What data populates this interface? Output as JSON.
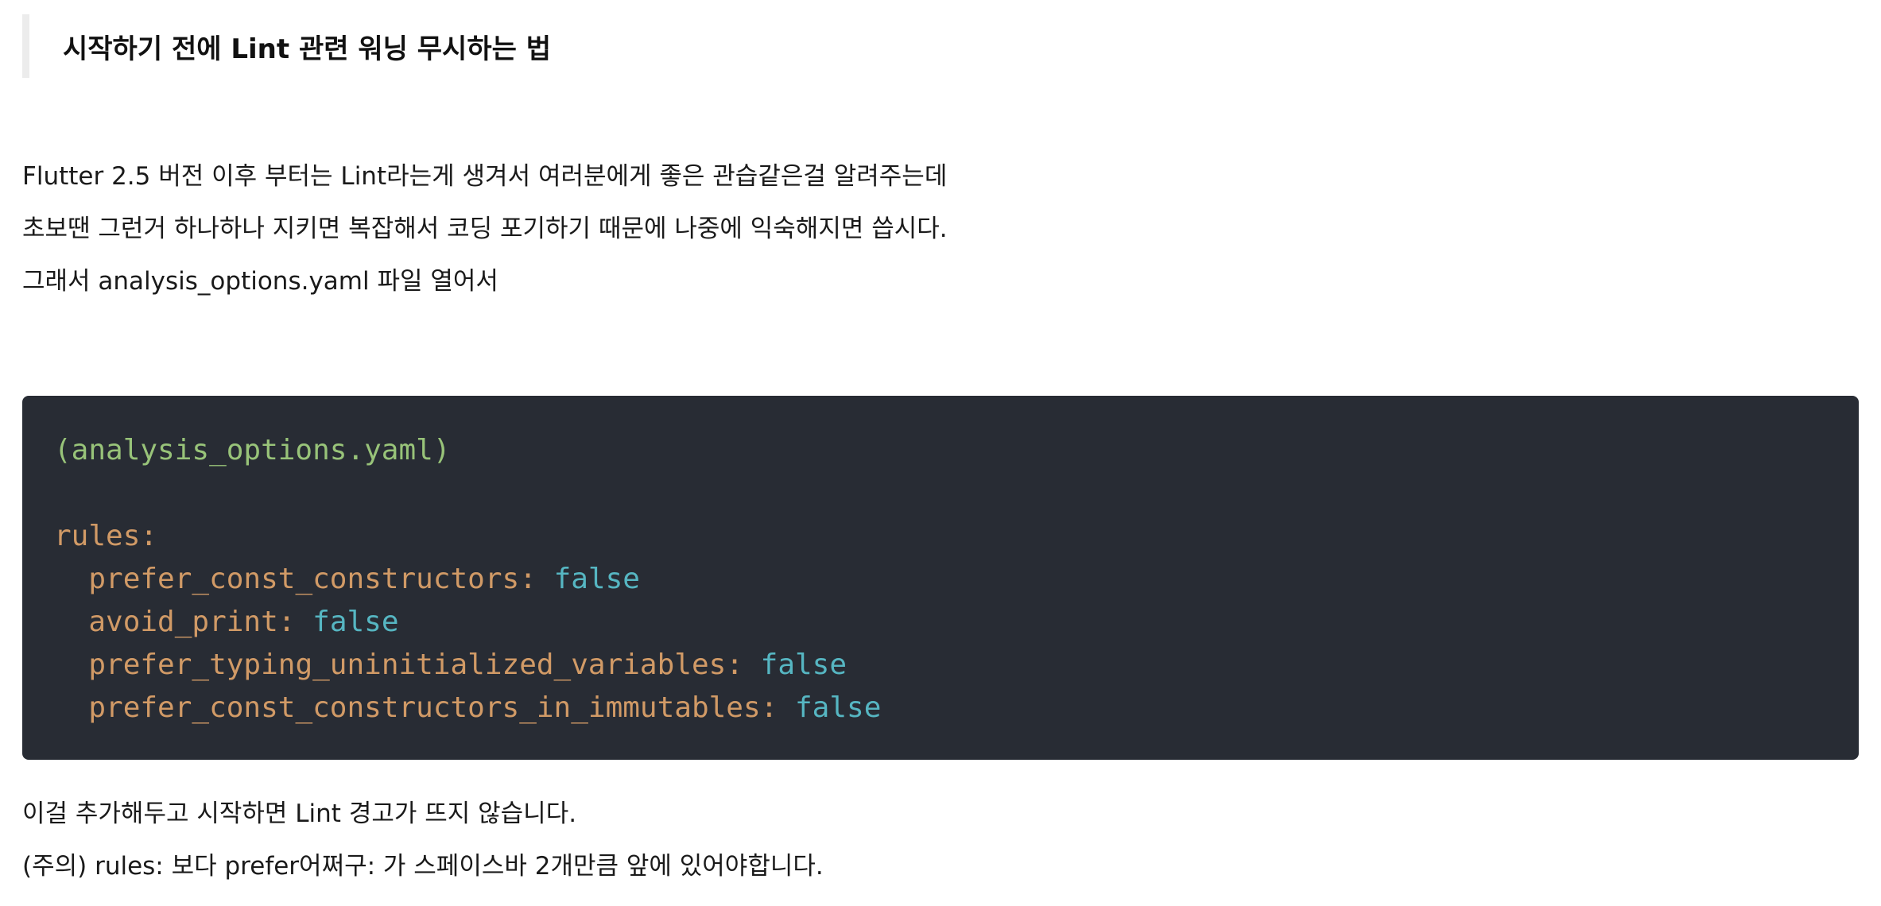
{
  "heading": "시작하기 전에 Lint 관련 워닝 무시하는 법",
  "intro": [
    "Flutter 2.5 버전 이후 부터는 Lint라는게 생겨서 여러분에게 좋은 관습같은걸 알려주는데",
    "초보땐 그런거 하나하나 지키면 복잡해서 코딩 포기하기 때문에 나중에 익숙해지면 씁시다.",
    "그래서 analysis_options.yaml 파일 열어서"
  ],
  "code": {
    "filename_comment": "(analysis_options.yaml)",
    "rules_key": "rules:",
    "rules": [
      {
        "key": "prefer_const_constructors:",
        "value": "false"
      },
      {
        "key": "avoid_print:",
        "value": "false"
      },
      {
        "key": "prefer_typing_uninitialized_variables:",
        "value": "false"
      },
      {
        "key": "prefer_const_constructors_in_immutables:",
        "value": "false"
      }
    ],
    "colors": {
      "background": "#282c34",
      "comment": "#98c379",
      "key": "#d19a66",
      "value": "#56b6c2"
    }
  },
  "outro": [
    "이걸 추가해두고 시작하면 Lint 경고가 뜨지 않습니다.",
    "(주의) rules: 보다 prefer어쩌구: 가 스페이스바 2개만큼 앞에 있어야합니다."
  ]
}
